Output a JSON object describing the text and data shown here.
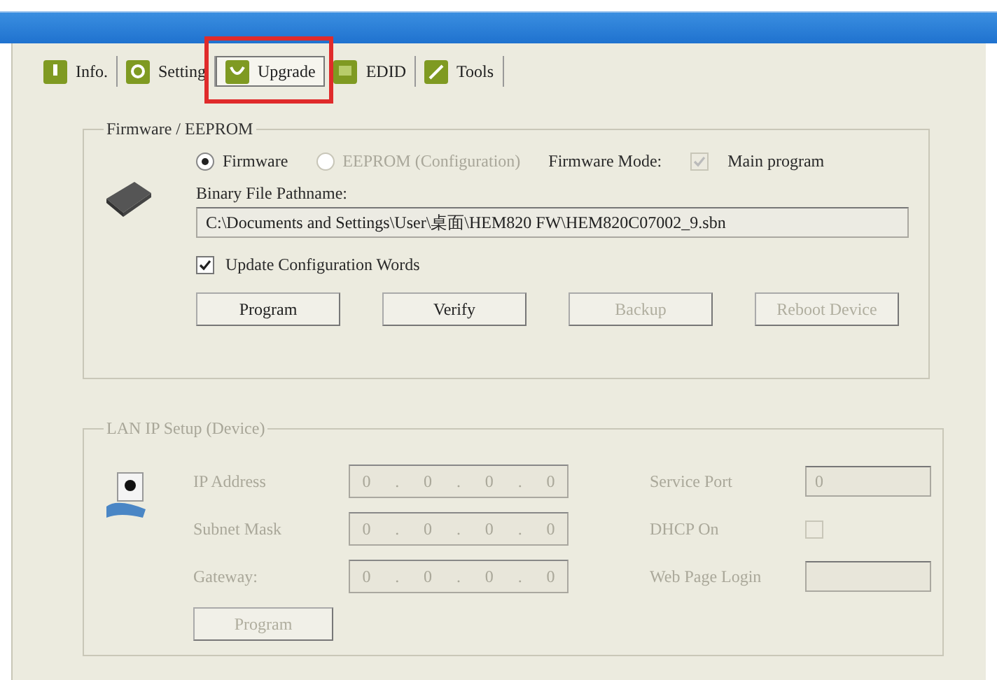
{
  "tabs": [
    {
      "label": "Info.",
      "selected": false,
      "highlighted": false
    },
    {
      "label": "Setting",
      "selected": false,
      "highlighted": false
    },
    {
      "label": "Upgrade",
      "selected": true,
      "highlighted": true
    },
    {
      "label": "EDID",
      "selected": false,
      "highlighted": false
    },
    {
      "label": "Tools",
      "selected": false,
      "highlighted": false
    }
  ],
  "firmware_group": {
    "title": "Firmware / EEPROM",
    "modes": [
      {
        "label": "Firmware",
        "selected": true,
        "disabled": false
      },
      {
        "label": "EEPROM (Configuration)",
        "selected": false,
        "disabled": true
      }
    ],
    "mode_label": "Firmware Mode:",
    "main_program": {
      "label": "Main program",
      "checked": true,
      "disabled": true
    },
    "path_label": "Binary File Pathname:",
    "path": "C:\\Documents and Settings\\User\\桌面\\HEM820 FW\\HEM820C07002_9.sbn",
    "update_config": {
      "label": "Update Configuration Words",
      "checked": true
    },
    "buttons": [
      {
        "label": "Program",
        "disabled": false
      },
      {
        "label": "Verify",
        "disabled": false
      },
      {
        "label": "Backup",
        "disabled": true
      },
      {
        "label": "Reboot Device",
        "disabled": true
      }
    ]
  },
  "lan_group": {
    "title": "LAN IP Setup (Device)",
    "disabled": true,
    "octet_separator": ".",
    "ip_fields": [
      {
        "label": "IP Address",
        "octets": [
          "0",
          "0",
          "0",
          "0"
        ]
      },
      {
        "label": "Subnet Mask",
        "octets": [
          "0",
          "0",
          "0",
          "0"
        ]
      },
      {
        "label": "Gateway:",
        "octets": [
          "0",
          "0",
          "0",
          "0"
        ]
      }
    ],
    "right_fields": [
      {
        "kind": "text",
        "label": "Service Port",
        "value": "0"
      },
      {
        "kind": "checkbox",
        "label": "DHCP On",
        "checked": false
      },
      {
        "kind": "text",
        "label": "Web Page Login"
      }
    ],
    "button": {
      "label": "Program",
      "disabled": true
    }
  }
}
